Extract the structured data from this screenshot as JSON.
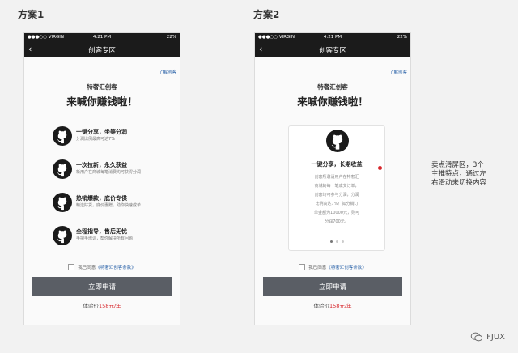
{
  "scheme1": {
    "label": "方案1"
  },
  "scheme2": {
    "label": "方案2"
  },
  "statusbar": {
    "carrier": "●●●○○ VIRGIN",
    "time": "4:21 PM",
    "battery": "22%"
  },
  "navbar": {
    "back_icon": "chevron-left-icon",
    "title": "创客专区"
  },
  "learn_link": "了解创客",
  "brand_sub": "特奢汇创客",
  "headline": "来喊你赚钱啦！",
  "features": [
    {
      "icon": "github-icon",
      "title": "一键分享，坐等分润",
      "desc": "分润比例最高可达7%"
    },
    {
      "icon": "github-icon",
      "title": "一次拉新，永久获益",
      "desc": "新用户在商城每笔消费均可获得分润"
    },
    {
      "icon": "github-icon",
      "title": "热销爆款，底价专供",
      "desc": "精选好货，底价惠赠，助你快速成单"
    },
    {
      "icon": "github-icon",
      "title": "全程指导，售后无忧",
      "desc": "手把手培训，帮你解决所有问题"
    }
  ],
  "agree": {
    "prefix": "我已同意",
    "link": "《特奢汇创客条款》"
  },
  "apply_button": "立即申请",
  "price": {
    "prefix": "体验价",
    "amount": "158元/年"
  },
  "card": {
    "icon": "github-icon",
    "title": "一键分享，长期收益",
    "body_lines": [
      "创客所邀请用户在特奢汇",
      "商城的每一笔成交订单，",
      "创客均可参与分润，分润",
      "比例高达7%！如分销订",
      "单金额为10000元，则可",
      "分润700元。"
    ]
  },
  "annotation": {
    "text": "卖点滑屏区，3个主推特点，通过左右滑动来切换内容"
  },
  "watermark": {
    "text": "FJUX",
    "icon": "wechat-icon"
  },
  "colors": {
    "accent_red": "#d7262b",
    "link_blue": "#2a62a8",
    "button_gray": "#5a5e65",
    "bar_black": "#1b1b1b"
  }
}
